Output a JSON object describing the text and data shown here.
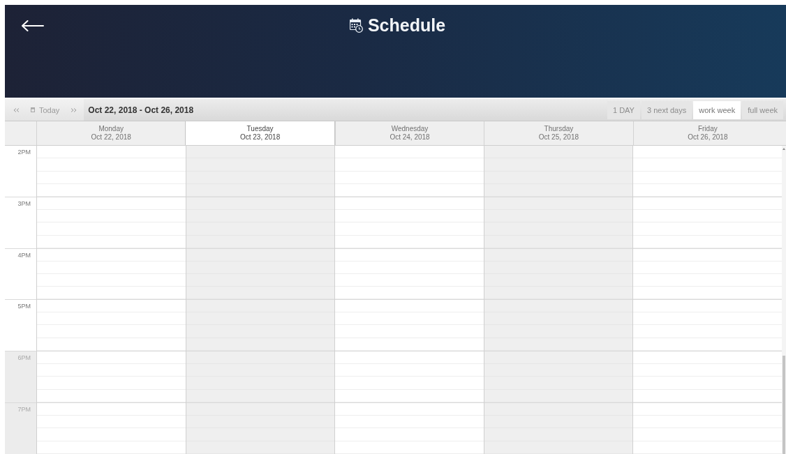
{
  "header": {
    "title": "Schedule"
  },
  "toolbar": {
    "today": "Today",
    "range": "Oct 22, 2018 - Oct 26, 2018",
    "views": [
      {
        "label": "1 DAY",
        "selected": false
      },
      {
        "label": "3 next days",
        "selected": false
      },
      {
        "label": "work week",
        "selected": true
      },
      {
        "label": "full week",
        "selected": false
      }
    ]
  },
  "days": [
    {
      "name": "Monday",
      "date": "Oct 22, 2018",
      "today": false,
      "shaded": false
    },
    {
      "name": "Tuesday",
      "date": "Oct 23, 2018",
      "today": true,
      "shaded": true
    },
    {
      "name": "Wednesday",
      "date": "Oct 24, 2018",
      "today": false,
      "shaded": false
    },
    {
      "name": "Thursday",
      "date": "Oct 25, 2018",
      "today": false,
      "shaded": true
    },
    {
      "name": "Friday",
      "date": "Oct 26, 2018",
      "today": false,
      "shaded": false
    }
  ],
  "hours": [
    {
      "label": "2PM",
      "off_hours": false
    },
    {
      "label": "3PM",
      "off_hours": false
    },
    {
      "label": "4PM",
      "off_hours": false
    },
    {
      "label": "5PM",
      "off_hours": false
    },
    {
      "label": "6PM",
      "off_hours": true
    },
    {
      "label": "7PM",
      "off_hours": true
    }
  ]
}
